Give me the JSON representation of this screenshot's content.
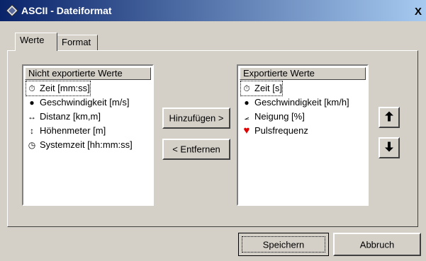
{
  "window": {
    "title": "ASCII - Dateiformat",
    "title_icon": "dialog-icon",
    "close_label": "X"
  },
  "tabs": [
    {
      "label": "Werte",
      "active": true
    },
    {
      "label": "Format",
      "active": false
    }
  ],
  "left_list": {
    "header": "Nicht exportierte Werte",
    "items": [
      {
        "label": "Zeit [mm:ss]",
        "icon": "stopwatch-icon",
        "glyph": "⏱",
        "selected": true
      },
      {
        "label": "Geschwindigkeit [m/s]",
        "icon": "speed-icon",
        "glyph": "●",
        "selected": false
      },
      {
        "label": "Distanz [km,m]",
        "icon": "distance-icon",
        "glyph": "↔",
        "selected": false
      },
      {
        "label": "Höhenmeter [m]",
        "icon": "altitude-icon",
        "glyph": "↕",
        "selected": false
      },
      {
        "label": "Systemzeit [hh:mm:ss]",
        "icon": "clock-icon",
        "glyph": "◷",
        "selected": false
      }
    ]
  },
  "middle_buttons": {
    "add_label": "Hinzufügen >",
    "remove_label": "< Entfernen"
  },
  "right_list": {
    "header": "Exportierte Werte",
    "items": [
      {
        "label": "Zeit [s]",
        "icon": "stopwatch-icon",
        "glyph": "⏱",
        "selected": true
      },
      {
        "label": "Geschwindigkeit [km/h]",
        "icon": "speed-icon",
        "glyph": "●",
        "selected": false
      },
      {
        "label": "Neigung [%]",
        "icon": "incline-icon",
        "glyph": "⦟",
        "selected": false
      },
      {
        "label": "Pulsfrequenz",
        "icon": "heart-icon",
        "glyph": "♥",
        "selected": false
      }
    ]
  },
  "order_buttons": {
    "up_icon": "move-up-icon",
    "down_icon": "move-down-icon"
  },
  "footer": {
    "save_label": "Speichern",
    "cancel_label": "Abbruch"
  },
  "colors": {
    "title_gradient_start": "#0a246a",
    "title_gradient_end": "#a6caf0",
    "dialog_face": "#d4d0c8",
    "heart": "#e00000"
  }
}
